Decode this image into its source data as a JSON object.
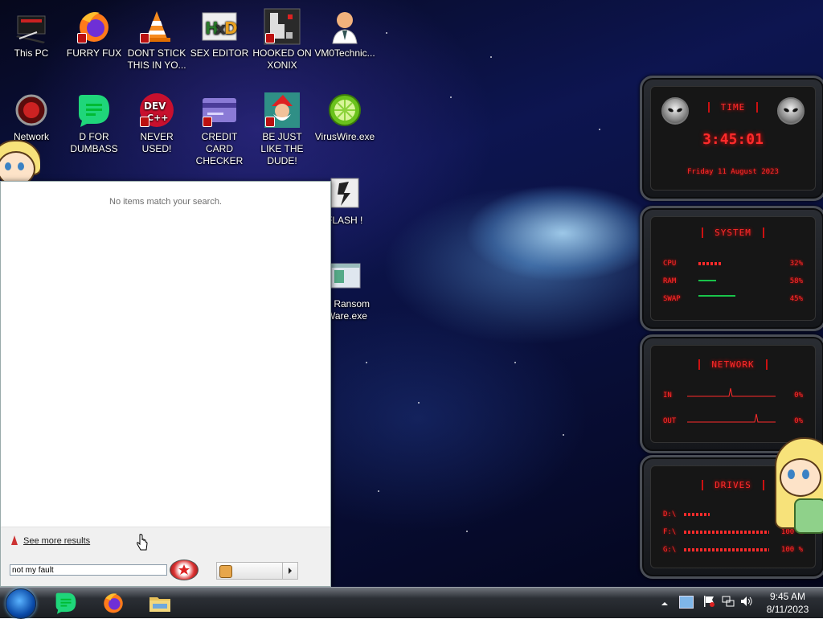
{
  "desktop": {
    "icons": [
      {
        "label": "This PC",
        "icon": "computer-icon"
      },
      {
        "label": "FURRY FUX",
        "icon": "firefox-icon"
      },
      {
        "label": "DONT STICK THIS IN YO...",
        "icon": "vlc-cone-icon"
      },
      {
        "label": "SEX EDITOR",
        "icon": "hxd-editor-icon"
      },
      {
        "label": "HOOKED ON XONIX",
        "icon": "xonix-game-icon"
      },
      {
        "label": "VM0Technic...",
        "icon": "doctor-avatar-icon"
      },
      {
        "label": "Network",
        "icon": "alien-network-icon"
      },
      {
        "label": "D FOR DUMBASS",
        "icon": "d-app-icon"
      },
      {
        "label": "NEVER USED!",
        "icon": "dev-cpp-icon"
      },
      {
        "label": "CREDIT CARD CHECKER",
        "icon": "credit-card-icon"
      },
      {
        "label": "BE JUST LIKE THE DUDE!",
        "icon": "santa-dude-icon"
      },
      {
        "label": "VirusWire.exe",
        "icon": "lime-icon"
      },
      {
        "label": "FLASH !",
        "icon": "flash-icon"
      },
      {
        "label": "y Ransom Ware.exe",
        "icon": "ransomware-window-icon"
      }
    ]
  },
  "widget": {
    "time": {
      "title": "TIME",
      "clock": "3:45:01",
      "date": "Friday 11 August 2023"
    },
    "system": {
      "title": "SYSTEM",
      "rows": [
        {
          "label": "CPU",
          "value": "32%",
          "level": 0.32
        },
        {
          "label": "RAM",
          "value": "58%",
          "level": 0.58
        },
        {
          "label": "SWAP",
          "value": "45%",
          "level": 0.45
        }
      ]
    },
    "network": {
      "title": "NETWORK",
      "rows": [
        {
          "label": "IN",
          "value": "0%"
        },
        {
          "label": "OUT",
          "value": "0%"
        }
      ]
    },
    "drives": {
      "title": "DRIVES",
      "rows": [
        {
          "label": "D:\\",
          "value": "",
          "level": 0.15
        },
        {
          "label": "F:\\",
          "value": "100 %",
          "level": 1.0
        },
        {
          "label": "G:\\",
          "value": "100 %",
          "level": 1.0
        }
      ]
    },
    "accent_color": "#ff2b2b"
  },
  "start_menu": {
    "no_results": "No items match your search.",
    "see_more": "See more results",
    "search_value": "not my fault",
    "search_icon": "search-star-icon",
    "shutdown_icon": "power-icon"
  },
  "taskbar": {
    "start_icon": "start-orb-icon",
    "apps": [
      {
        "icon": "d-app-icon"
      },
      {
        "icon": "firefox-icon"
      },
      {
        "icon": "file-explorer-icon"
      }
    ],
    "tray": {
      "icons": [
        "show-hidden-icons-icon",
        "display-icon",
        "flag-icon",
        "network-icon",
        "volume-icon"
      ],
      "time": "9:45 AM",
      "date": "8/11/2023"
    }
  }
}
